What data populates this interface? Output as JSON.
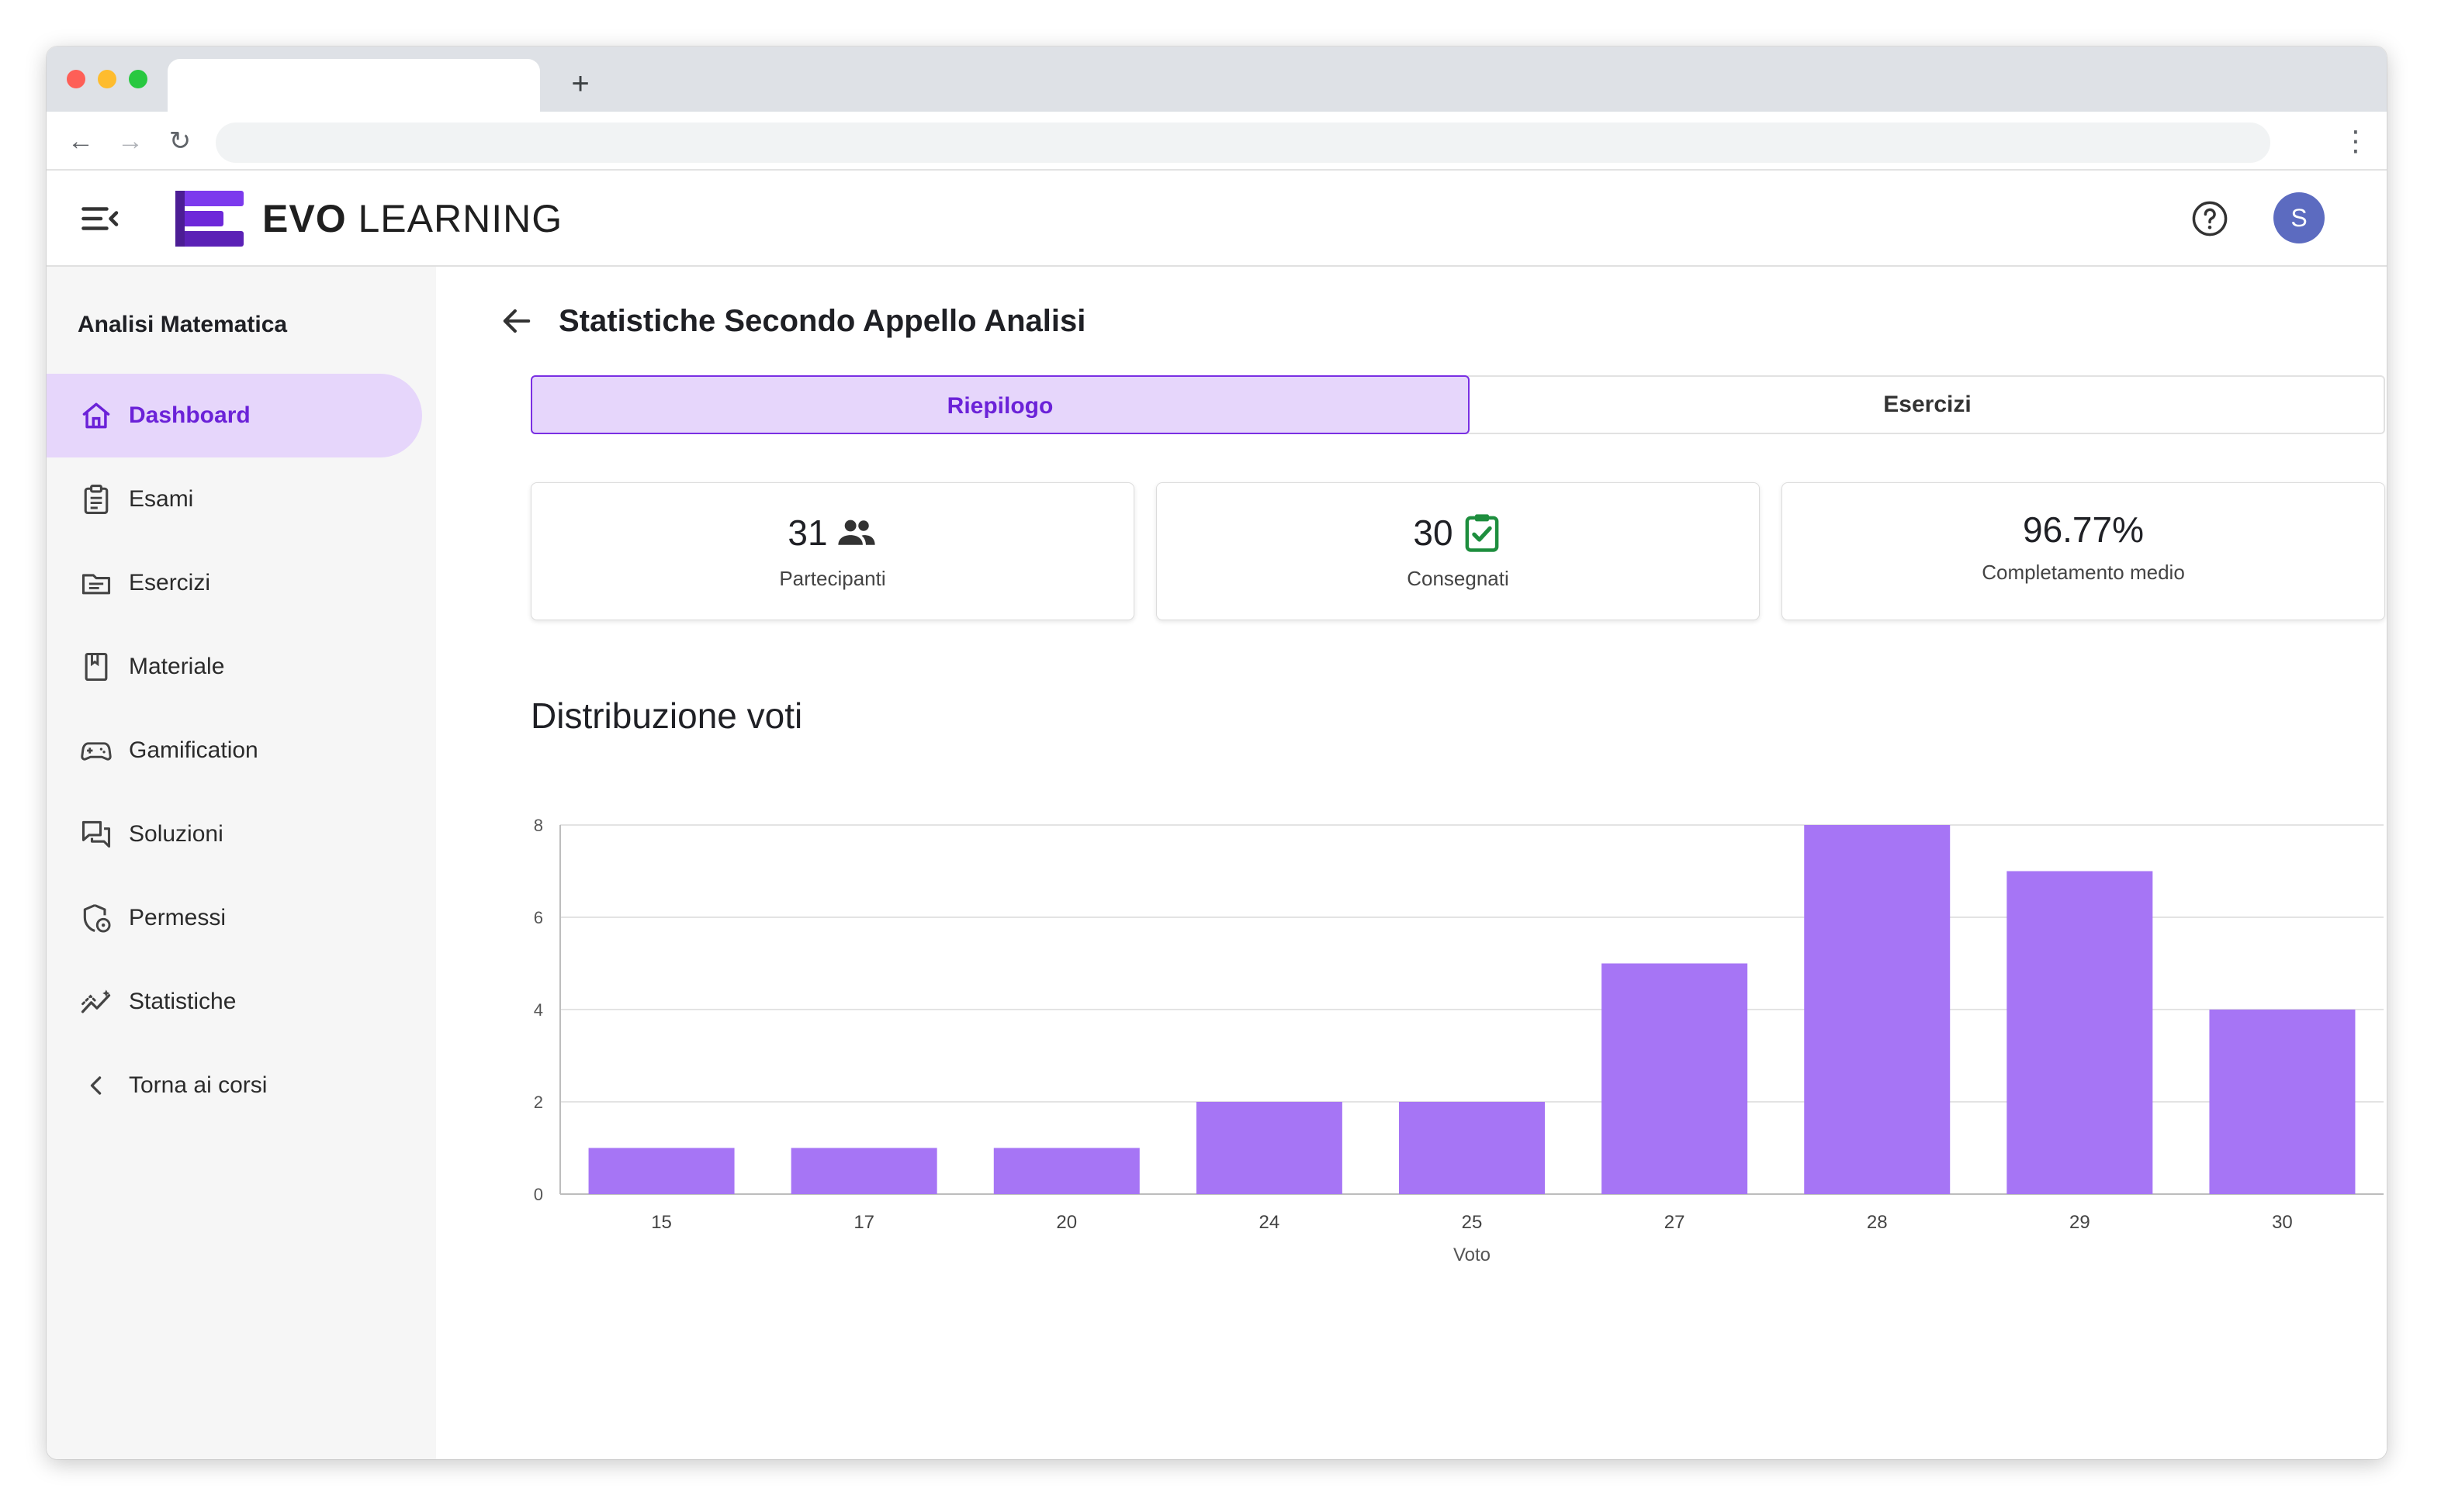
{
  "browser": {
    "new_tab_label": "+",
    "back_glyph": "←",
    "forward_glyph": "→",
    "reload_glyph": "↻",
    "menu_glyph": "⋮"
  },
  "header": {
    "brand_bold": "EVO",
    "brand_light": " LEARNING",
    "avatar_initial": "S",
    "logo_colors": [
      "#7c3aed",
      "#6d28d9",
      "#5b21b6"
    ]
  },
  "sidebar": {
    "course_title": "Analisi Matematica",
    "items": [
      {
        "label": "Dashboard",
        "icon": "home-icon",
        "active": true
      },
      {
        "label": "Esami",
        "icon": "clipboard-icon",
        "active": false
      },
      {
        "label": "Esercizi",
        "icon": "folder-list-icon",
        "active": false
      },
      {
        "label": "Materiale",
        "icon": "book-icon",
        "active": false
      },
      {
        "label": "Gamification",
        "icon": "gamepad-icon",
        "active": false
      },
      {
        "label": "Soluzioni",
        "icon": "forum-icon",
        "active": false
      },
      {
        "label": "Permessi",
        "icon": "shield-lock-icon",
        "active": false
      },
      {
        "label": "Statistiche",
        "icon": "chart-line-icon",
        "active": false
      },
      {
        "label": "Torna ai corsi",
        "icon": "chevron-left-icon",
        "active": false
      }
    ]
  },
  "main": {
    "page_title": "Statistiche Secondo Appello Analisi",
    "tabs": [
      {
        "label": "Riepilogo",
        "active": true
      },
      {
        "label": "Esercizi",
        "active": false
      }
    ],
    "stats": [
      {
        "value": "31",
        "label": "Partecipanti",
        "icon": "people-icon"
      },
      {
        "value": "30",
        "label": "Consegnati",
        "icon": "clipboard-check-icon"
      },
      {
        "value": "96.77%",
        "label": "Completamento medio"
      }
    ],
    "chart_heading": "Distribuzione voti"
  },
  "colors": {
    "accent": "#7a2fe3",
    "accent_light": "#e6d6fb",
    "bar": "#a675f5",
    "success": "#1e8e3e",
    "avatar": "#5c6bc0"
  },
  "chart_data": {
    "type": "bar",
    "title": "",
    "categories": [
      "15",
      "17",
      "20",
      "24",
      "25",
      "27",
      "28",
      "29",
      "30"
    ],
    "values": [
      1,
      1,
      1,
      2,
      2,
      5,
      8,
      7,
      4
    ],
    "xlabel": "Voto",
    "ylabel": "",
    "ylim": [
      0,
      8
    ],
    "yticks": [
      0,
      2,
      4,
      6,
      8
    ],
    "grid": true,
    "legend": "none"
  }
}
